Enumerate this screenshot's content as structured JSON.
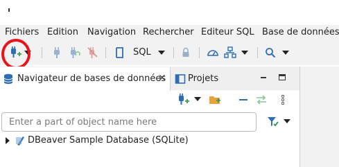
{
  "menu": {
    "items": [
      "Fichiers",
      "Edition",
      "Navigation",
      "Rechercher",
      "Editeur SQL",
      "Base de données"
    ]
  },
  "toolbar": {
    "sql_label": "SQL",
    "icons": [
      "new-connection-icon",
      "connect-icon",
      "reconnect-icon",
      "disconnect-icon",
      "sql-editor-icon",
      "lock-icon",
      "dashboard-icon",
      "transaction-log-icon",
      "search-icon"
    ]
  },
  "tabs": {
    "navigator_label": "Navigateur de bases de données",
    "close_glyph": "✕",
    "projects_label": "Projets"
  },
  "search": {
    "placeholder": "Enter a part of object name here"
  },
  "tree": {
    "items": [
      {
        "label": "DBeaver Sample Database (SQLite)"
      }
    ]
  },
  "colors": {
    "highlight_circle": "#e8141b",
    "accent_blue": "#2f6db5",
    "connect_green": "#3e9d4c"
  }
}
